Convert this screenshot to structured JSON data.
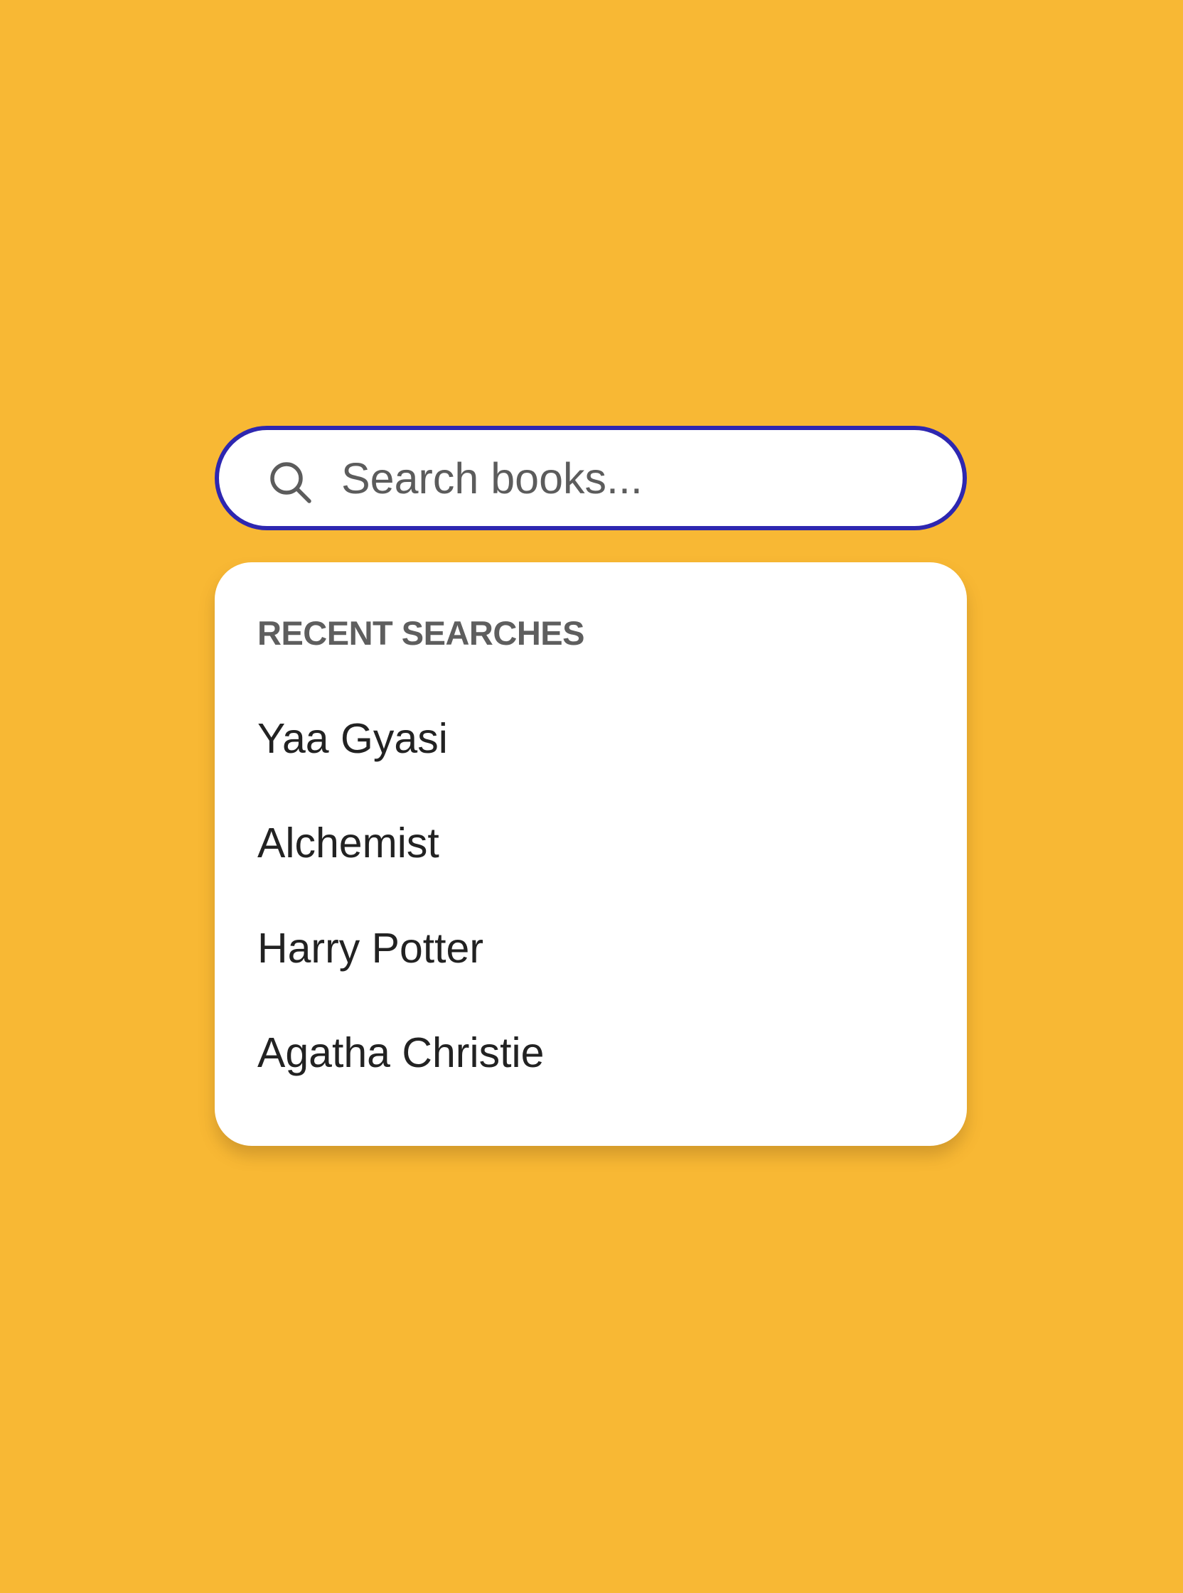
{
  "search": {
    "placeholder": "Search books...",
    "icon": "search-icon"
  },
  "recent": {
    "heading": "RECENT SEARCHES",
    "items": [
      {
        "label": "Yaa Gyasi"
      },
      {
        "label": "Alchemist"
      },
      {
        "label": "Harry Potter"
      },
      {
        "label": "Agatha Christie"
      }
    ]
  },
  "colors": {
    "background": "#F8B834",
    "search_border": "#2E27B0",
    "panel": "#FFFFFF",
    "heading_text": "#5E5E5E",
    "item_text": "#222222"
  }
}
